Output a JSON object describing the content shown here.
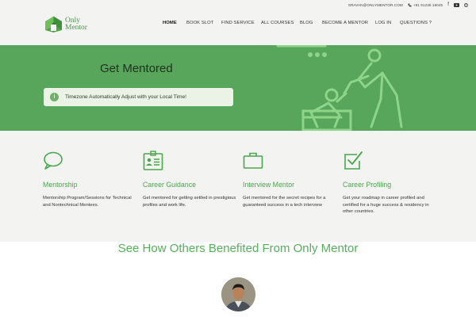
{
  "header": {
    "email": "SRAVAN@ONLYMENTOR.COM",
    "phone": "+91 91236 16045",
    "social_icons": [
      "facebook-icon",
      "youtube-icon",
      "skype-icon"
    ],
    "logo": {
      "line1": "Only",
      "line2": "Mentor"
    },
    "nav": [
      "HOME",
      "BOOK SLOT",
      "FIND SERVICE",
      "ALL COURSES",
      "BLOG",
      "BECOME A MENTOR",
      "LOG IN",
      "QUESTIONS ?"
    ],
    "active_nav": "HOME"
  },
  "hero": {
    "title": "Get Mentored",
    "notice": "Timezone Automatically Adjust with your Local Time!",
    "notice_icon": "info-icon",
    "background_color": "#58a55c"
  },
  "features": [
    {
      "icon": "speech-bubble-icon",
      "title": "Mentorship",
      "desc": "Mentorship Program/Sessions for Technical and Nontechnical Mentees."
    },
    {
      "icon": "id-badge-icon",
      "title": "Career Guidance",
      "desc": "Get mentored for getting settled in prestigious profiles and work life."
    },
    {
      "icon": "briefcase-icon",
      "title": "Interview Mentor",
      "desc": "Get mentored for the secret recipes for a guaranteed success in a tech interview"
    },
    {
      "icon": "checkbox-icon",
      "title": "Career Profiling",
      "desc": "Get your roadmap in career profiled and certified for a huge success & residency in other countries."
    }
  ],
  "testimonials": {
    "heading": "See How Others Benefited From Only Mentor"
  },
  "colors": {
    "accent": "#4aa74e",
    "hero": "#58a55c",
    "section_bg": "#f3f3f1"
  }
}
